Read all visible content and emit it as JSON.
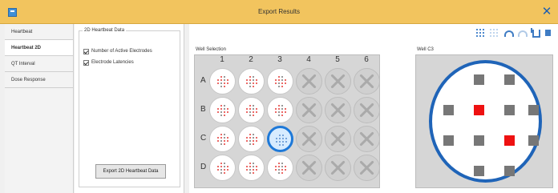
{
  "window": {
    "title": "Export Results"
  },
  "icons": {
    "app": "app-icon",
    "close": "close-icon"
  },
  "nav": {
    "items": [
      {
        "label": "Heartbeat",
        "active": false
      },
      {
        "label": "Heartbeat 2D",
        "active": true
      },
      {
        "label": "QT Interval",
        "active": false
      },
      {
        "label": "Dose Response",
        "active": false
      }
    ]
  },
  "options": {
    "group_title": "2D Heartbeat Data",
    "checkboxes": [
      {
        "label": "Number of Active Electrodes",
        "checked": true
      },
      {
        "label": "Electrode Latencies",
        "checked": true
      }
    ],
    "export_button": "Export 2D Heartbeat Data"
  },
  "toolbar": {
    "icons": [
      "grid-view-icon",
      "list-view-icon",
      "undo-icon",
      "redo-icon",
      "export-icon",
      "settings-icon"
    ]
  },
  "plate": {
    "label": "Well Selection",
    "columns": [
      "1",
      "2",
      "3",
      "4",
      "5",
      "6"
    ],
    "rows": [
      "A",
      "B",
      "C",
      "D"
    ],
    "selected_well": "C3",
    "active_columns": [
      "1",
      "2",
      "3"
    ],
    "colors": {
      "selected_border": "#1e79d8",
      "active_dot": "#e53935",
      "inactive_dot": "#777777",
      "disabled": "#aaaaaa"
    }
  },
  "well_view": {
    "label": "Well C3",
    "electrode_colors": {
      "active": "#ee1111",
      "inactive": "#777777"
    },
    "electrode_grid": [
      [
        "none",
        "inactive",
        "inactive",
        "none"
      ],
      [
        "inactive",
        "active",
        "inactive",
        "inactive"
      ],
      [
        "inactive",
        "inactive",
        "active",
        "inactive"
      ],
      [
        "none",
        "inactive",
        "inactive",
        "none"
      ]
    ]
  }
}
